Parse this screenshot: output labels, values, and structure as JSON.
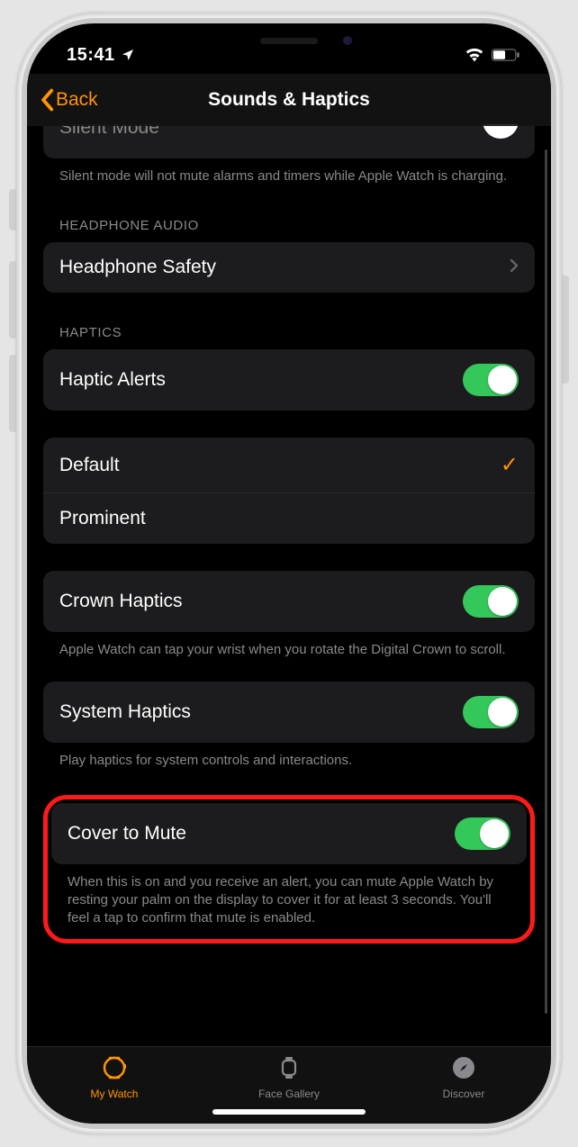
{
  "status": {
    "time": "15:41"
  },
  "nav": {
    "back_label": "Back",
    "title": "Sounds & Haptics"
  },
  "silent": {
    "label": "Silent Mode",
    "footer": "Silent mode will not mute alarms and timers while Apple Watch is charging."
  },
  "headphone": {
    "section": "HEADPHONE AUDIO",
    "safety_label": "Headphone Safety"
  },
  "haptics": {
    "section": "HAPTICS",
    "alerts_label": "Haptic Alerts",
    "default_label": "Default",
    "prominent_label": "Prominent"
  },
  "crown": {
    "label": "Crown Haptics",
    "footer": "Apple Watch can tap your wrist when you rotate the Digital Crown to scroll."
  },
  "system": {
    "label": "System Haptics",
    "footer": "Play haptics for system controls and interactions."
  },
  "cover": {
    "label": "Cover to Mute",
    "footer": "When this is on and you receive an alert, you can mute Apple Watch by resting your palm on the display to cover it for at least 3 seconds. You'll feel a tap to confirm that mute is enabled."
  },
  "tabs": {
    "my_watch": "My Watch",
    "face_gallery": "Face Gallery",
    "discover": "Discover"
  }
}
